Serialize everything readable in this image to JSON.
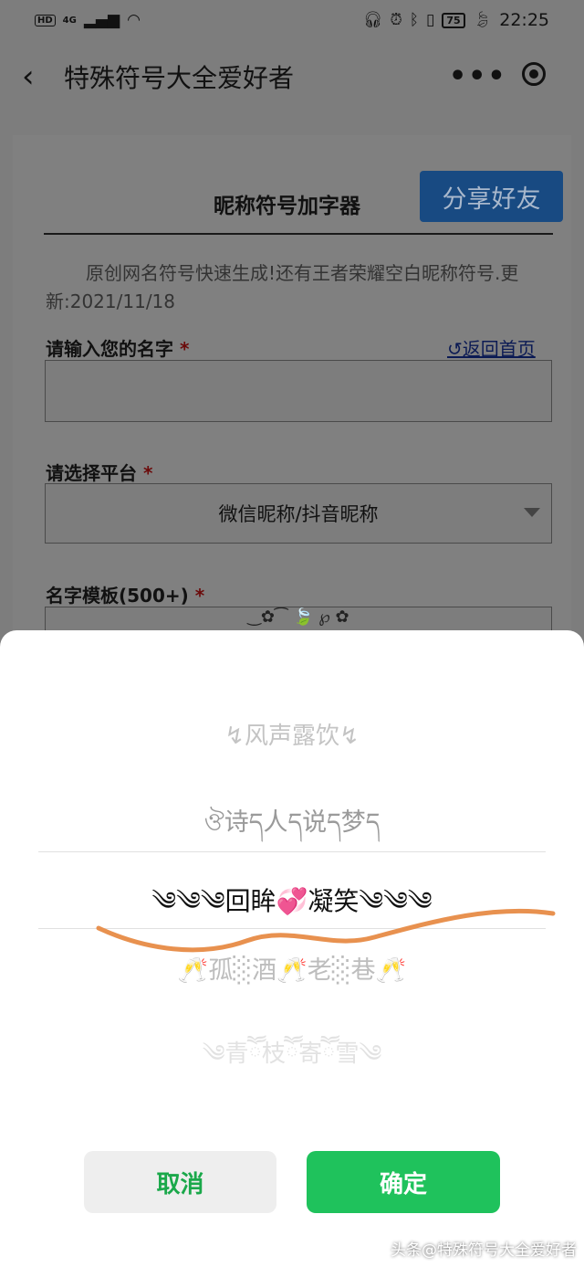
{
  "status_bar": {
    "hd": "HD",
    "network": "4G",
    "signal_icon": "signal-icon",
    "wifi_icon": "wifi-icon",
    "battery_level": "75",
    "time": "22:25"
  },
  "nav": {
    "title": "特殊符号大全爱好者",
    "more": "•••"
  },
  "page": {
    "generator_title": "昵称符号加字器",
    "share_label": "分享好友",
    "intro": "原创网名符号快速生成!还有王者荣耀空白昵称符号.更新:2021/11/18",
    "name_label": "请输入您的名字",
    "required_mark": "*",
    "home_link": "↺返回首页",
    "name_value": "",
    "platform_label": "请选择平台",
    "platform_value": "微信昵称/抖音昵称",
    "template_label": "名字模板(500+)",
    "template_preview": "‿✿⁀ 🍃 ℘ ✿"
  },
  "picker": {
    "items": [
      "↯风声露饮↯",
      "ঔ诗ད人ད说ད梦ད",
      "༄༄༄回眸💞凝笑༄༄༄",
      "🥂孤░酒🥂老░巷🥂",
      "༄青ཽ枝ཽ寄ཽ雪༄"
    ],
    "cancel_label": "取消",
    "confirm_label": "确定"
  },
  "watermark": "头条@特殊符号大全爱好者",
  "colors": {
    "share_bg": "#184a82",
    "confirm_bg": "#1fc25c",
    "cancel_text": "#1aa84a",
    "annotation_stroke": "#e8914f"
  }
}
